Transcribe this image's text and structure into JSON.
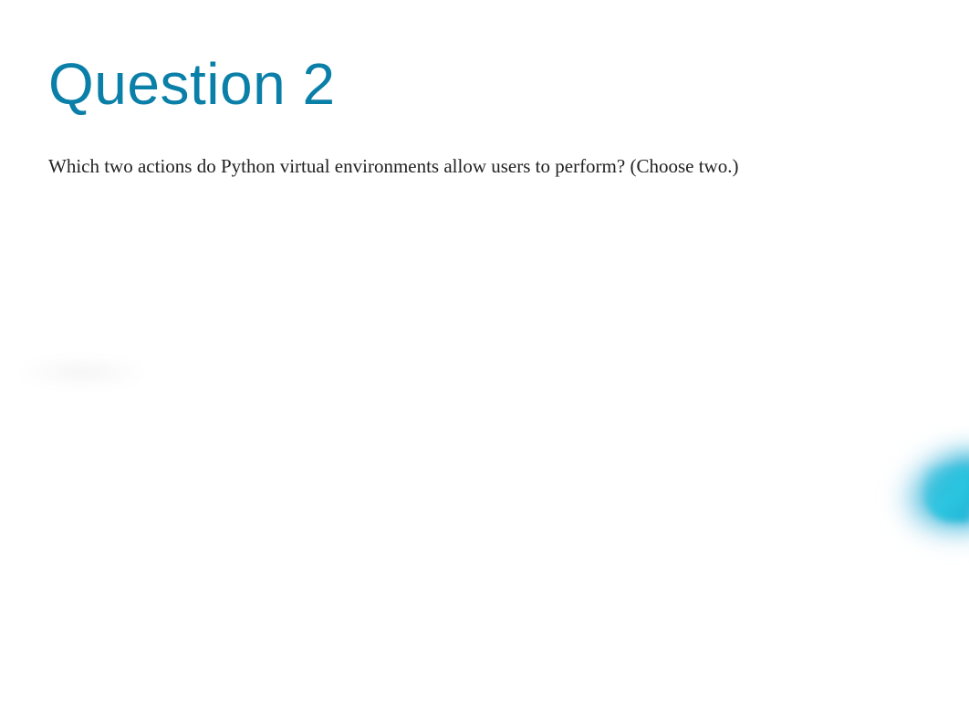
{
  "question": {
    "title": "Question 2",
    "text": "Which two actions do Python virtual environments allow users to perform? (Choose two.)"
  }
}
